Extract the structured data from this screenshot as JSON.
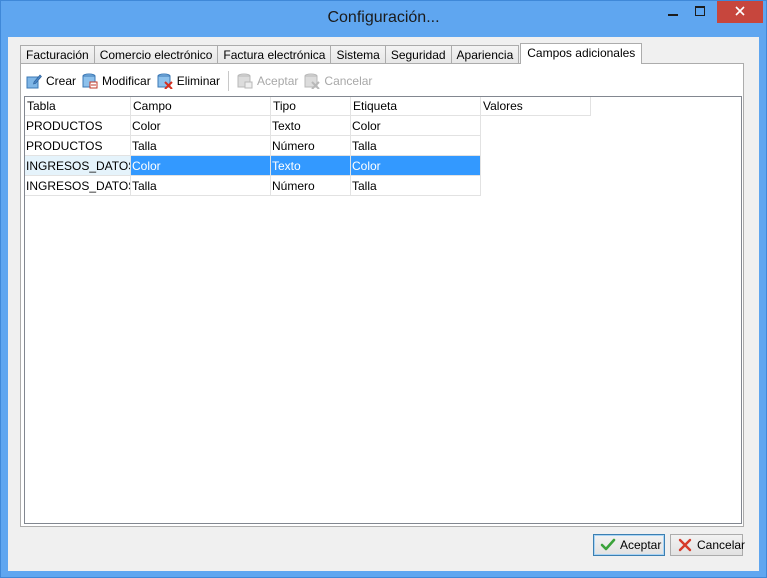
{
  "window": {
    "title": "Configuración...",
    "controls": {
      "minimize": "▁",
      "maximize": "☐",
      "close": "✕"
    }
  },
  "tabs": [
    {
      "label": "Facturación",
      "active": false
    },
    {
      "label": "Comercio electrónico",
      "active": false
    },
    {
      "label": "Factura electrónica",
      "active": false
    },
    {
      "label": "Sistema",
      "active": false
    },
    {
      "label": "Seguridad",
      "active": false
    },
    {
      "label": "Apariencia",
      "active": false
    },
    {
      "label": "Campos adicionales",
      "active": true
    }
  ],
  "toolbar": {
    "crear": "Crear",
    "modificar": "Modificar",
    "eliminar": "Eliminar",
    "aceptar": "Aceptar",
    "cancelar": "Cancelar"
  },
  "grid": {
    "columns": [
      "Tabla",
      "Campo",
      "Tipo",
      "Etiqueta",
      "Valores"
    ],
    "rows": [
      [
        "PRODUCTOS",
        "Color",
        "Texto",
        "Color"
      ],
      [
        "PRODUCTOS",
        "Talla",
        "Número",
        "Talla"
      ],
      [
        "INGRESOS_DATOS",
        "Color",
        "Texto",
        "Color"
      ],
      [
        "INGRESOS_DATOS",
        "Talla",
        "Número",
        "Talla"
      ]
    ],
    "selected_row": 2
  },
  "buttons": {
    "aceptar": "Aceptar",
    "cancelar": "Cancelar"
  },
  "colors": {
    "title_bar": "#5fa6f0",
    "selection": "#3399ff",
    "close_button": "#c7463d"
  }
}
